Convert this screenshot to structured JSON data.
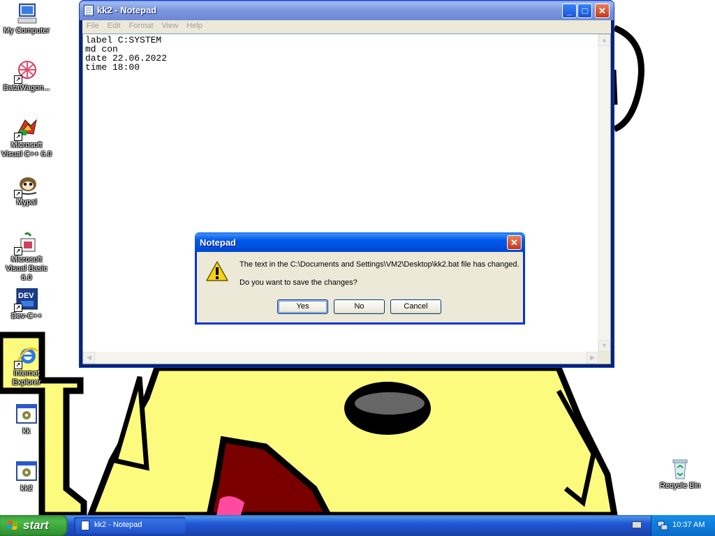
{
  "desktop": {
    "icons": [
      {
        "label": "My Computer"
      },
      {
        "label": "DataWagon..."
      },
      {
        "label": "Microsoft Visual C++ 6.0"
      },
      {
        "label": "Mypal"
      },
      {
        "label": "Microsoft Visual Basic 6.0"
      },
      {
        "label": "Dev-C++"
      },
      {
        "label": "Internet Explorer"
      },
      {
        "label": "kk"
      },
      {
        "label": "kk2"
      },
      {
        "label": "Recycle Bin"
      }
    ]
  },
  "notepad": {
    "title": "kk2 - Notepad",
    "menu": [
      "File",
      "Edit",
      "Format",
      "View",
      "Help"
    ],
    "content": "label C:SYSTEM\nmd con\ndate 22.06.2022\ntime 18:00"
  },
  "dialog": {
    "title": "Notepad",
    "message1": "The text in the C:\\Documents and Settings\\VM2\\Desktop\\kk2.bat file has changed.",
    "message2": "Do you want to save the changes?",
    "buttons": {
      "yes": "Yes",
      "no": "No",
      "cancel": "Cancel"
    }
  },
  "taskbar": {
    "start_label": "start",
    "tasks": [
      {
        "label": "kk2 - Notepad"
      }
    ],
    "clock": "10:37 AM"
  },
  "colors": {
    "wallpaper_yellow": "#fdfb7e",
    "outline": "#000000",
    "taskbar_blue": "#245edb",
    "start_green": "#3c9a3c"
  }
}
